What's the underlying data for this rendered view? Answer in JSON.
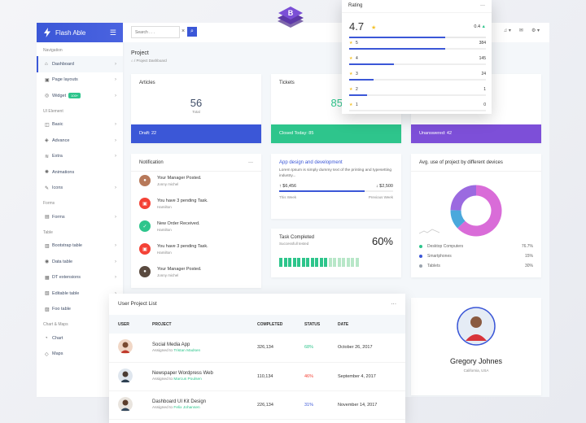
{
  "brand": {
    "name": "Flash Able"
  },
  "search": {
    "placeholder": "Search . . ."
  },
  "nav": {
    "cap_navigation": "Navigation",
    "dashboard": "Dashboard",
    "page_layouts": "Page layouts",
    "widget": "Widget",
    "widget_badge": "100+",
    "cap_ui": "UI Element",
    "basic": "Basic",
    "advance": "Advance",
    "extra": "Extra",
    "animations": "Animations",
    "icons": "Icons",
    "cap_forms": "Forms",
    "forms": "Forms",
    "cap_table": "Table",
    "bootstrap_table": "Bootstrap table",
    "data_table": "Data table",
    "dt_extensions": "DT extensions",
    "editable_table": "Editable table",
    "foo_table": "Foo table",
    "cap_chart": "Chart & Maps",
    "chart": "Chart",
    "maps": "Maps"
  },
  "page": {
    "title": "Project",
    "breadcrumb": "Project Dashboard"
  },
  "articles": {
    "title": "Articles",
    "value": "56",
    "sub": "Total",
    "footer": "Draft: 22"
  },
  "tickets": {
    "title": "Tickets",
    "value": "85",
    "footer": "Closed Today: 85"
  },
  "unanswered": {
    "footer": "Unanswered: 42"
  },
  "notification": {
    "title": "Notification",
    "items": [
      {
        "title": "Your Manager Posted.",
        "sub": "Jonny michel"
      },
      {
        "title": "You have 3 pending Task.",
        "sub": "Hamilton"
      },
      {
        "title": "New Order Received.",
        "sub": "Hamilton"
      },
      {
        "title": "You have 3 pending Task.",
        "sub": "Hamilton"
      },
      {
        "title": "Your Manager Posted.",
        "sub": "Jonny michel"
      }
    ]
  },
  "appdev": {
    "title": "App design and development",
    "text": "Lorem Ipsum is simply dummy text of the printing and typesetting industry...",
    "left_value": "↑ $6,456",
    "right_value": "↓ $2,500",
    "left_label": "This Week",
    "right_label": "Previous Week",
    "progress": 0.75
  },
  "task": {
    "title": "Task Completed",
    "sub": "Successfull tested",
    "pct": "60%",
    "filled": 11,
    "total": 18
  },
  "devices": {
    "title": "Avg. use of project by different devices",
    "chart_data": {
      "type": "pie",
      "categories": [
        "Desktop Computers",
        "Smartphones",
        "Tablets"
      ],
      "values": [
        76.7,
        15,
        30
      ],
      "labels": [
        "76.7%",
        "15%",
        "30%"
      ],
      "colors": [
        "#2ec58c",
        "#3b57d7",
        "#9aa3ad"
      ]
    }
  },
  "rating": {
    "title": "Rating",
    "score": "4.7",
    "top_value": "0.4",
    "rows": [
      {
        "n": "5",
        "count": "384",
        "frac": 0.7
      },
      {
        "n": "4",
        "count": "145",
        "frac": 0.33
      },
      {
        "n": "3",
        "count": "24",
        "frac": 0.18
      },
      {
        "n": "2",
        "count": "1",
        "frac": 0.13
      },
      {
        "n": "1",
        "count": "0",
        "frac": 0
      }
    ]
  },
  "projects": {
    "title": "User Project List",
    "headers": [
      "USER",
      "PROJECT",
      "COMPLETED",
      "STATUS",
      "DATE"
    ],
    "rows": [
      {
        "project": "Social Media App",
        "assigned": "Assigned to",
        "person": "Tristan Madsen",
        "completed": "326,134",
        "status": "68%",
        "status_color": "#2ec58c",
        "date": "October 26, 2017"
      },
      {
        "project": "Newspaper Wordpress Web",
        "assigned": "Assigned to",
        "person": "Marcus Poulsen",
        "completed": "110,134",
        "status": "46%",
        "status_color": "#f44236",
        "date": "September 4, 2017"
      },
      {
        "project": "Dashboard UI Kit Design",
        "assigned": "Assigned to",
        "person": "Felix Johansen",
        "completed": "226,134",
        "status": "31%",
        "status_color": "#3b57d7",
        "date": "November 14, 2017"
      }
    ]
  },
  "profile": {
    "name": "Gregory Johnes",
    "location": "California, USA"
  },
  "colors": {
    "primary": "#3b57d7",
    "green": "#2ec58c",
    "purple": "#7d4fd8",
    "red": "#f44236"
  }
}
